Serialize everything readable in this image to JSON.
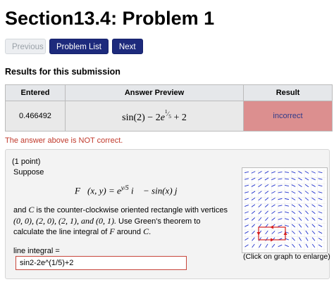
{
  "header": {
    "title": "Section13.4: Problem 1"
  },
  "nav": {
    "previous": "Previous",
    "problem_list": "Problem List",
    "next": "Next"
  },
  "results": {
    "heading": "Results for this submission",
    "columns": [
      "Entered",
      "Answer Preview",
      "Result"
    ],
    "entered": "0.466492",
    "preview": "sin(2) − 2e^(1/5) + 2",
    "result": "incorrect",
    "message": "The answer above is NOT correct."
  },
  "problem": {
    "points": "(1 point)",
    "suppose": "Suppose",
    "vector_field": "F(x, y) = e^(y/5) i − sin(x) j",
    "description_a": "and ",
    "curve_symbol": "C",
    "description_b": " is the counter-clockwise oriented rectangle with vertices ",
    "vertices": "(0, 0), (2, 0), (2, 1), and (0, 1).",
    "description_c": " Use Green's theorem to calculate the line integral of ",
    "field_symbol": "F",
    "description_d": " around ",
    "description_e": ".",
    "answer_label": "line integral =",
    "answer_value": "sin2-2e^(1/5)+2",
    "graph_caption": "(Click on graph to enlarge)"
  },
  "colors": {
    "primary": "#1d2a7c",
    "incorrect_bg": "#dc8f8f",
    "error_text": "#c0392b",
    "arrows": "#2233cc",
    "rectangle": "#d62020"
  }
}
